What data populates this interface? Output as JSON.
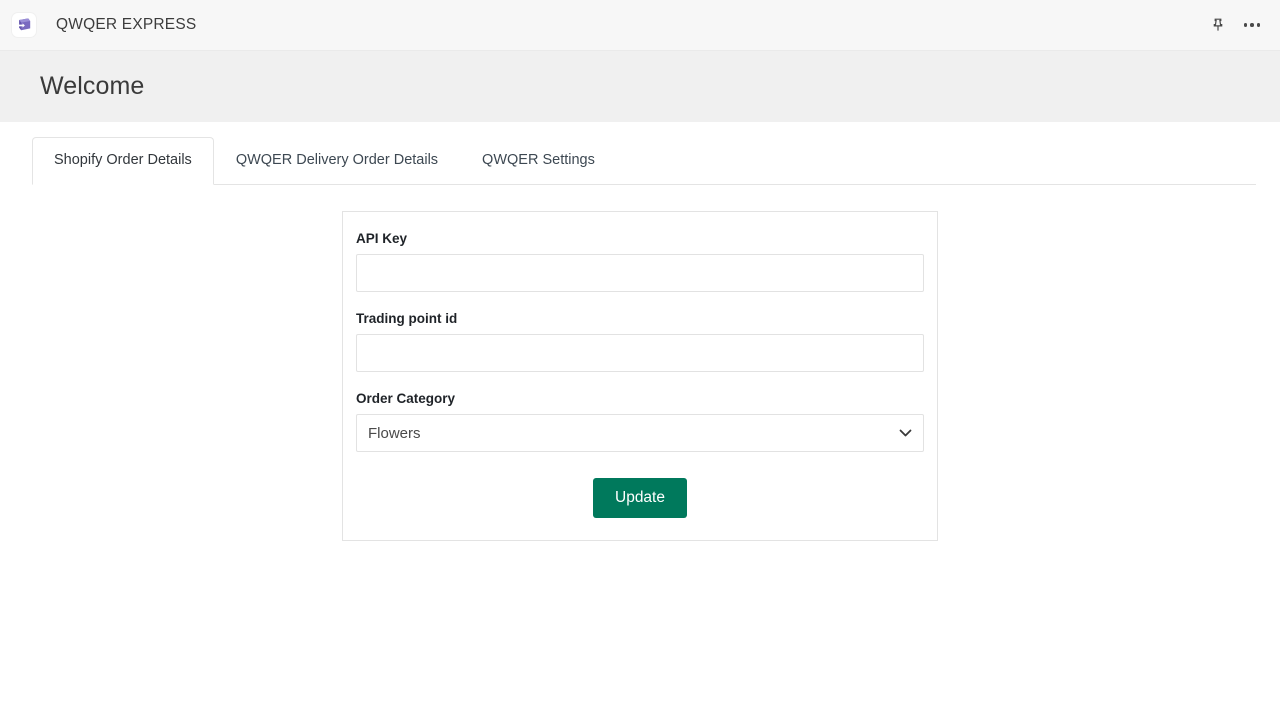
{
  "topbar": {
    "app_name": "QWQER EXPRESS",
    "logo_icon": "app-logo-icon",
    "logo_color": "#7a6ac0",
    "pin_icon": "pin-icon",
    "more_icon": "more-options-icon"
  },
  "header": {
    "title": "Welcome"
  },
  "tabs": [
    {
      "label": "Shopify Order Details",
      "active": true
    },
    {
      "label": "QWQER Delivery Order Details",
      "active": false
    },
    {
      "label": "QWQER Settings",
      "active": false
    }
  ],
  "form": {
    "api_key": {
      "label": "API Key",
      "value": "",
      "placeholder": ""
    },
    "trading_point_id": {
      "label": "Trading point id",
      "value": "",
      "placeholder": ""
    },
    "order_category": {
      "label": "Order Category",
      "value": "Flowers",
      "options": [
        "Flowers"
      ],
      "chevron_icon": "chevron-down-icon"
    },
    "submit": {
      "label": "Update",
      "color": "#00795c"
    }
  }
}
